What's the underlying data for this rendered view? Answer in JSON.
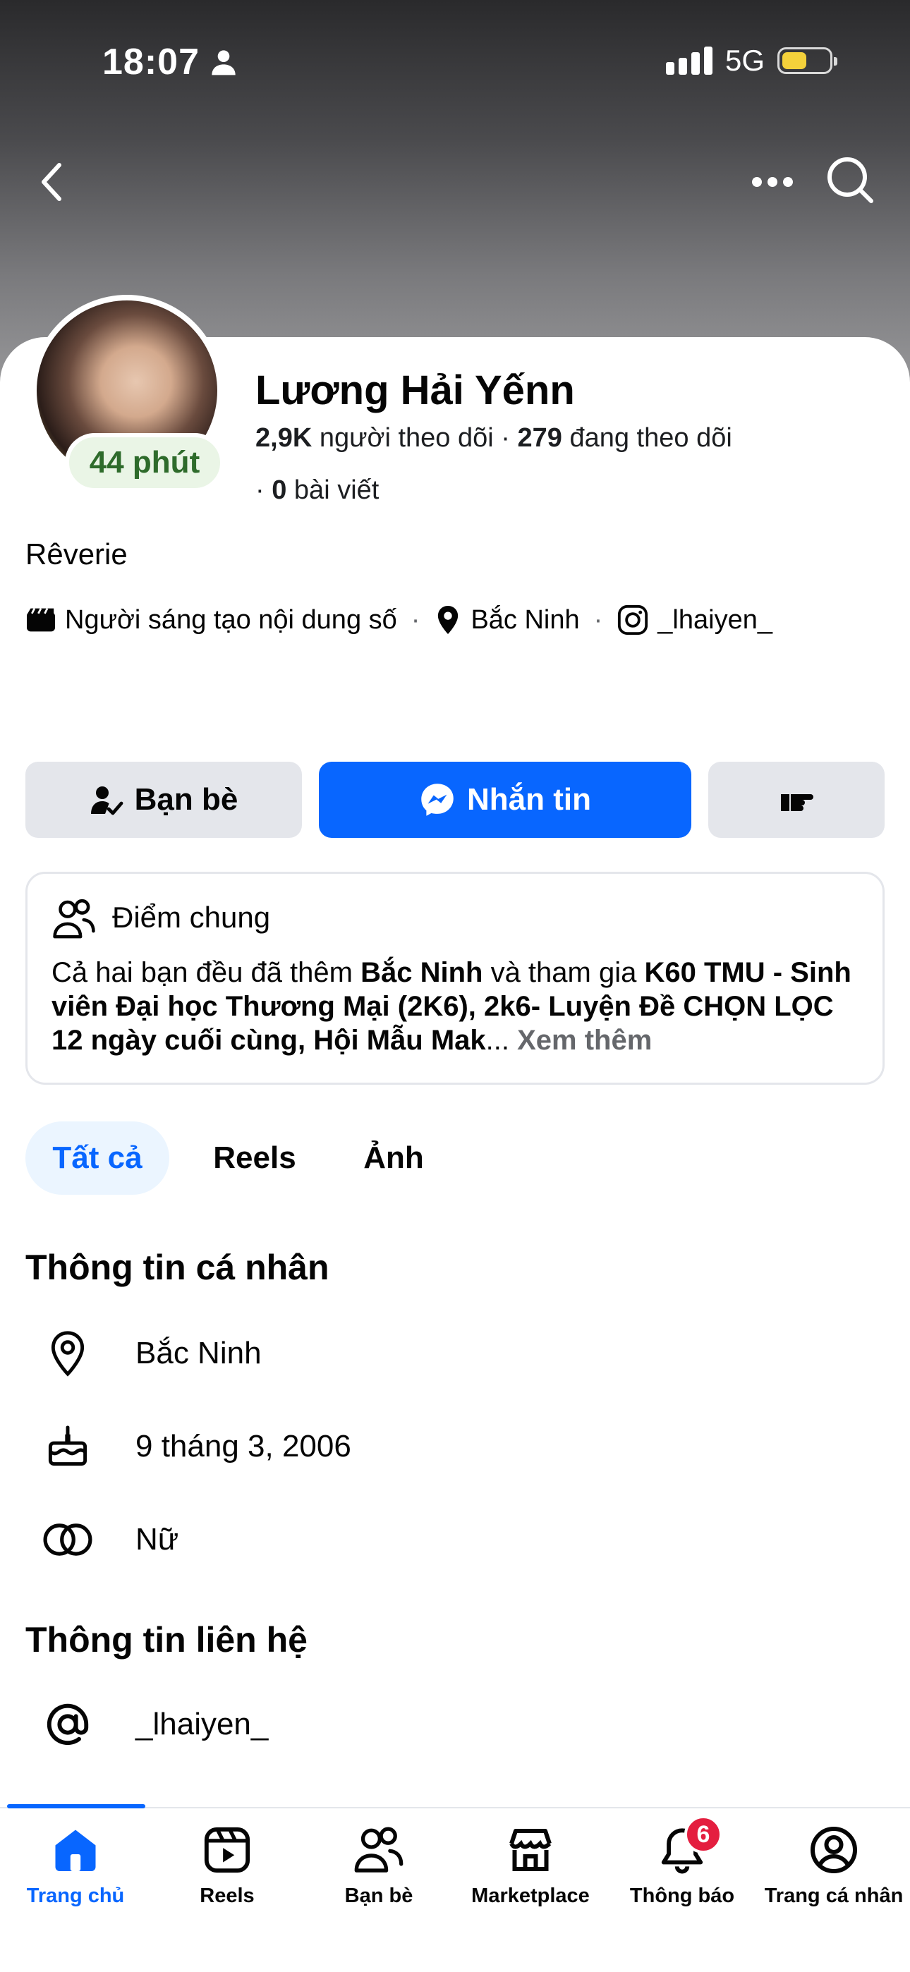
{
  "status_bar": {
    "time": "18:07",
    "network": "5G"
  },
  "profile": {
    "name": "Lương Hải Yếnn",
    "active_status": "44 phút",
    "followers_count": "2,9K",
    "followers_label": "người theo dõi",
    "following_count": "279",
    "following_label": "đang theo dõi",
    "posts_count": "0",
    "posts_label": "bài viết",
    "bio": "Rêverie",
    "category": "Người sáng tạo nội dung số",
    "location": "Bắc Ninh",
    "instagram": "_lhaiyen_"
  },
  "actions": {
    "friends_label": "Bạn bè",
    "message_label": "Nhắn tin"
  },
  "mutual": {
    "title": "Điểm chung",
    "text_prefix": "Cả hai bạn đều đã thêm ",
    "place": "Bắc Ninh",
    "text_middle": " và tham gia ",
    "groups": "K60 TMU - Sinh viên Đại học Thương Mại (2K6), 2k6- Luyện Đề CHỌN LỌC 12 ngày cuối cùng, Hội Mẫu Mak",
    "ellipsis": "... ",
    "see_more": "Xem thêm"
  },
  "tabs": {
    "all": "Tất cả",
    "reels": "Reels",
    "photos": "Ảnh"
  },
  "personal_info": {
    "title": "Thông tin cá nhân",
    "location": "Bắc Ninh",
    "birthday": "9 tháng 3, 2006",
    "gender": "Nữ"
  },
  "contact_info": {
    "title": "Thông tin liên hệ",
    "username": "_lhaiyen_"
  },
  "bottom_nav": {
    "home": "Trang chủ",
    "reels": "Reels",
    "friends": "Bạn bè",
    "marketplace": "Marketplace",
    "notifications": "Thông báo",
    "notifications_badge": "6",
    "profile": "Trang cá nhân"
  },
  "colors": {
    "accent": "#0866ff",
    "badge": "#e41e3f",
    "active_green": "#2e6b2b",
    "battery": "#f4d13b"
  },
  "icons": [
    "back-icon",
    "more-icon",
    "search-icon",
    "person-icon",
    "signal-icon",
    "battery-icon",
    "clapperboard-icon",
    "location-pin-icon",
    "instagram-icon",
    "friend-check-icon",
    "messenger-icon",
    "thumb-point-icon",
    "people-icon",
    "cake-icon",
    "gender-rings-icon",
    "at-icon",
    "home-icon",
    "reels-icon",
    "friends-icon",
    "marketplace-icon",
    "bell-icon",
    "profile-icon"
  ]
}
